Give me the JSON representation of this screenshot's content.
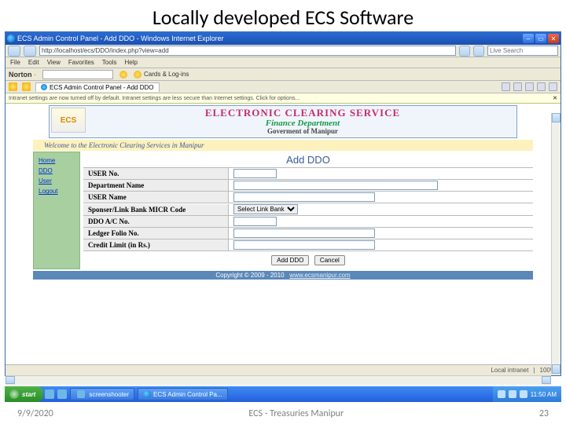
{
  "slide": {
    "title": "Locally developed ECS Software",
    "date": "9/9/2020",
    "footer_center": "ECS - Treasuries Manipur",
    "page_number": "23"
  },
  "window": {
    "title": "ECS Admin Control Panel - Add DDO - Windows Internet Explorer",
    "url": "http://localhost/ecs/DDO/index.php?view=add",
    "search_placeholder": "Live Search",
    "menus": [
      "File",
      "Edit",
      "View",
      "Favorites",
      "Tools",
      "Help"
    ],
    "norton_label": "Norton",
    "norton_chip": "Cards & Log-ins",
    "tab_label": "ECS Admin Control Panel - Add DDO",
    "infobar": "Intranet settings are now turned off by default. Intranet settings are less secure than Internet settings. Click for options...",
    "status_zone": "Local intranet",
    "status_zoom": "100%"
  },
  "banner": {
    "logo": "ECS",
    "line1": "ELECTRONIC CLEARING SERVICE",
    "line2": "Finance Department",
    "line3": "Goverment of Manipur"
  },
  "welcome": "Welcome to the Electronic Clearing Services in Manipur",
  "nav": {
    "items": [
      "Home",
      "DDO",
      "User",
      "Logout"
    ]
  },
  "form": {
    "title": "Add DDO",
    "fields": {
      "user_no": "USER No.",
      "dept_name": "Department Name",
      "user_name": "USER Name",
      "bank": "Sponser/Link Bank MICR Code",
      "ddo_ac": "DDO A/C No.",
      "ledger": "Ledger Folio No.",
      "credit": "Credit Limit (in Rs.)"
    },
    "select_placeholder": "Select Link Bank",
    "btn_submit": "Add DDO",
    "btn_cancel": "Cancel"
  },
  "copyright": {
    "text": "Copyright © 2009 - 2010",
    "link": "www.ecsmanipur.com"
  },
  "taskbar": {
    "start": "start",
    "items": [
      "screenshooter",
      "ECS Admin Control Pa..."
    ],
    "clock": "11:50 AM"
  }
}
